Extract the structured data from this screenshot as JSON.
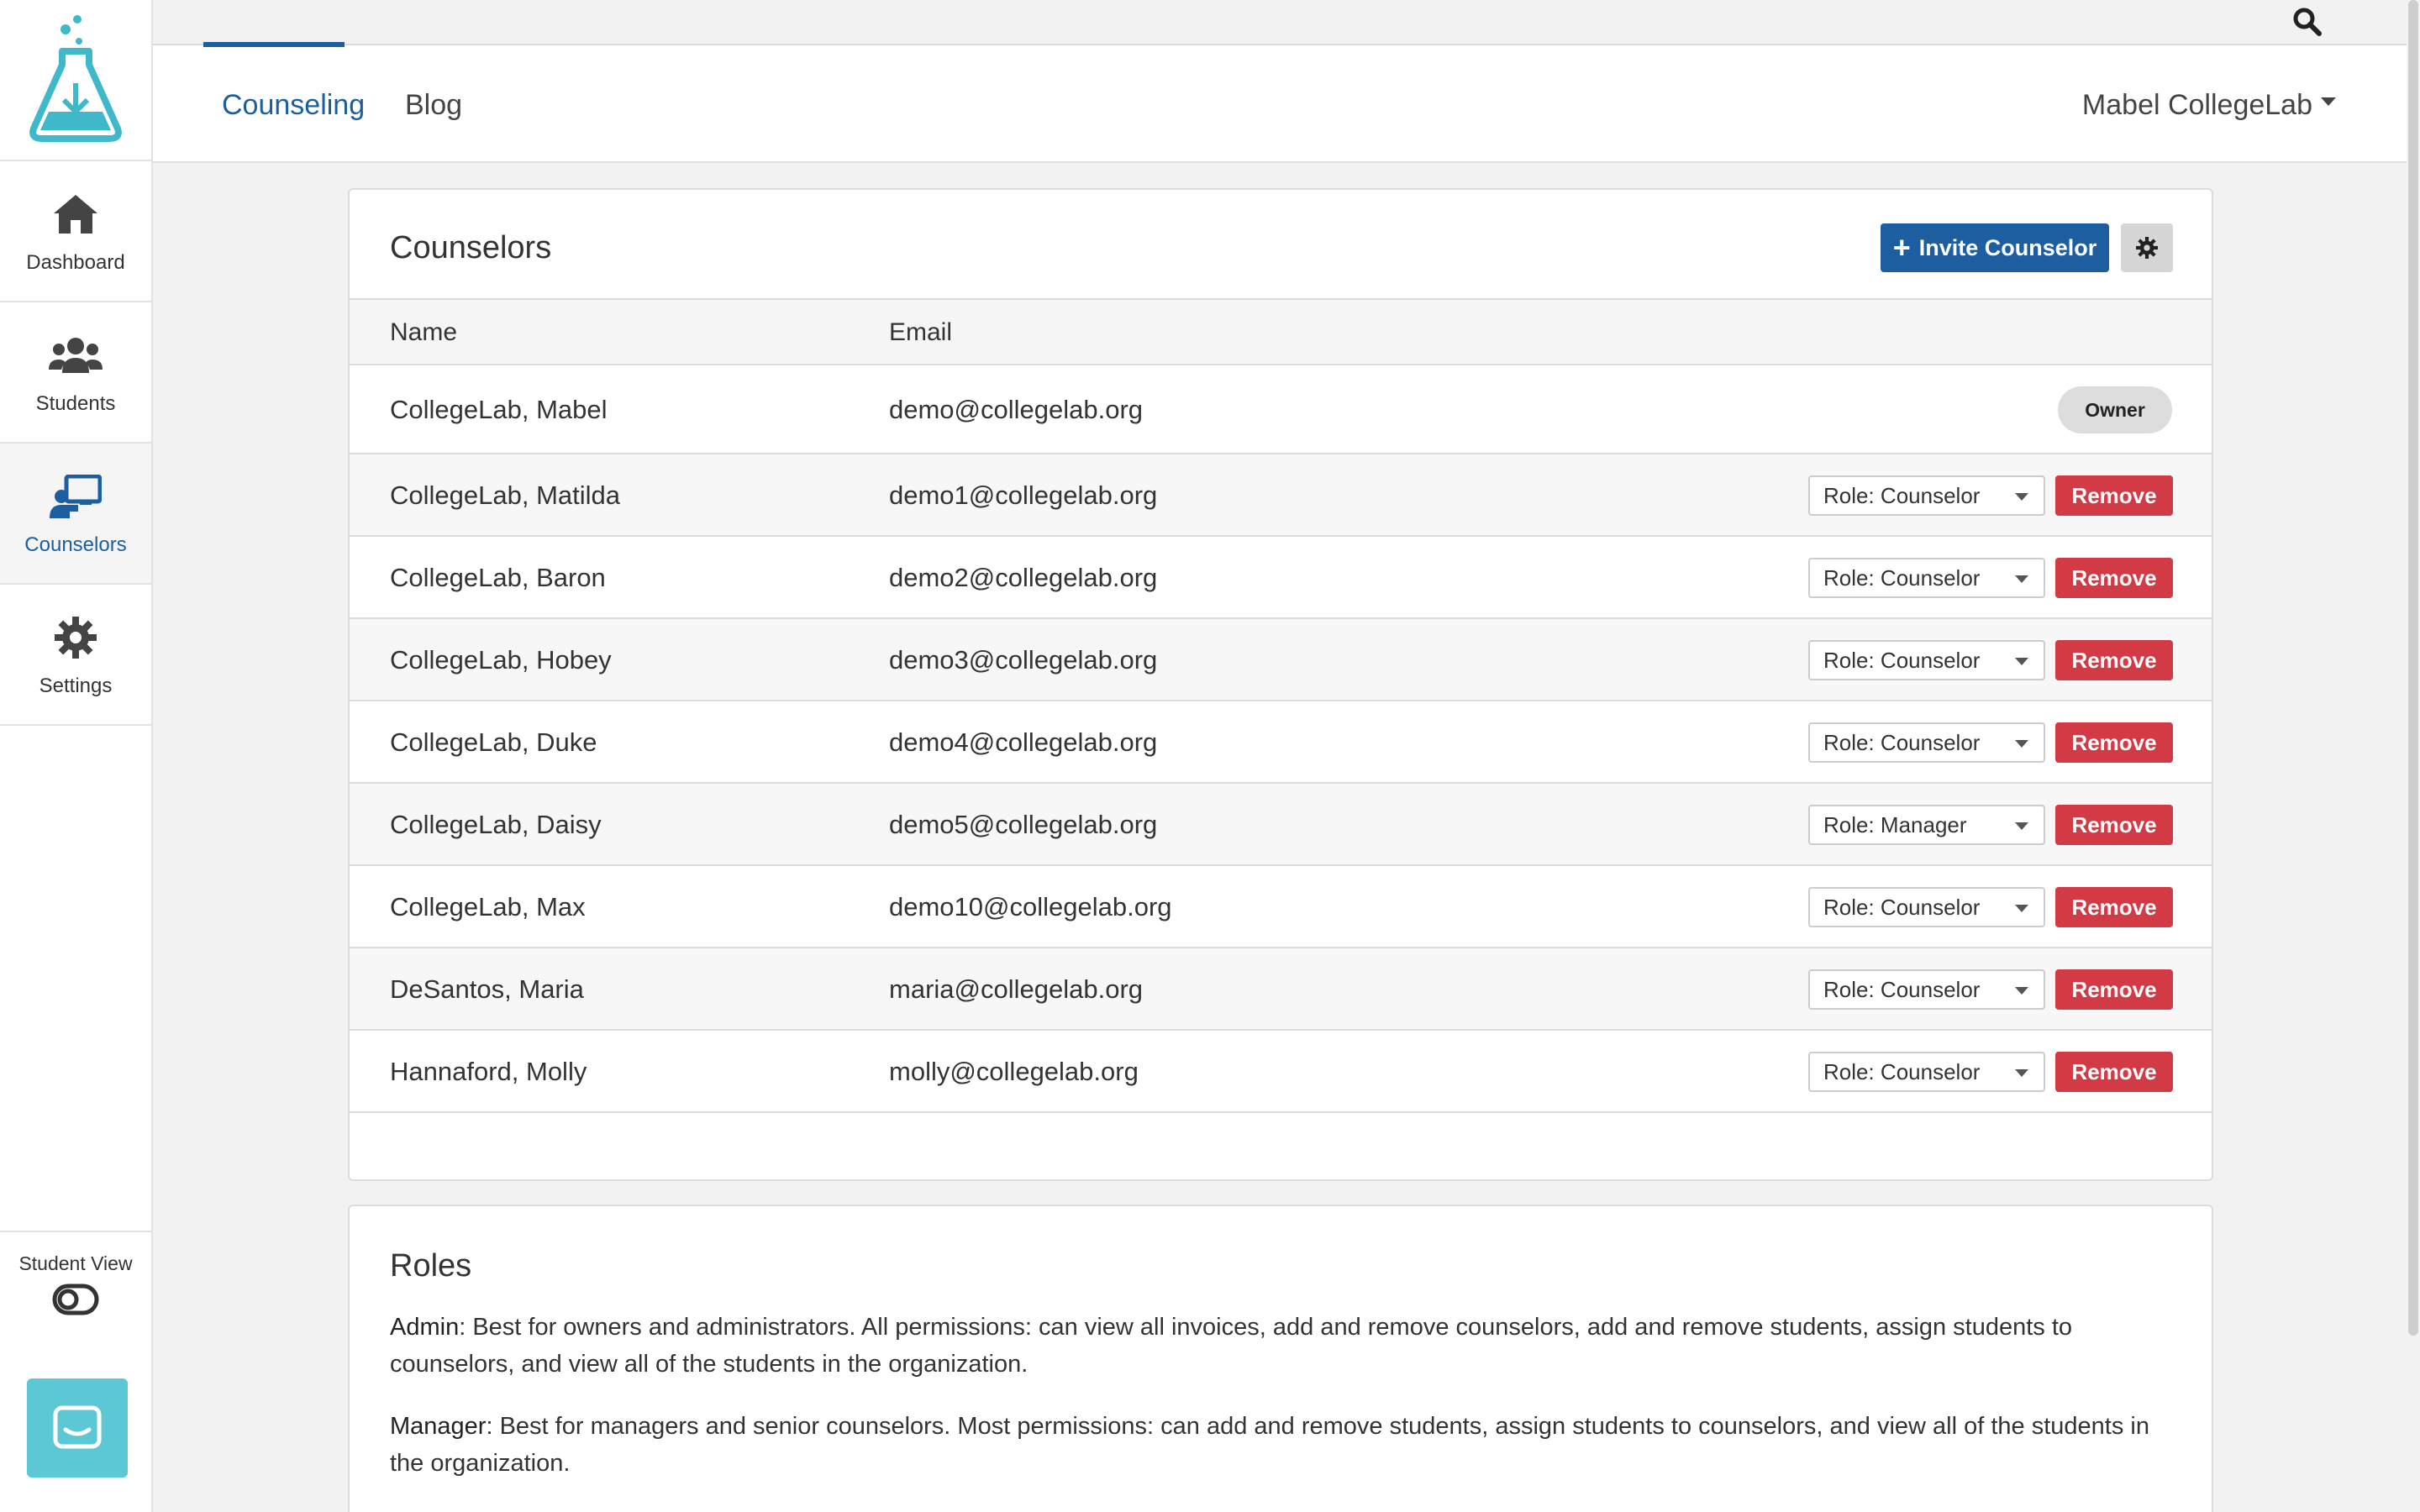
{
  "sidebar": {
    "items": [
      {
        "label": "Dashboard",
        "icon": "home-icon"
      },
      {
        "label": "Students",
        "icon": "users-icon"
      },
      {
        "label": "Counselors",
        "icon": "chalkboard-teacher-icon"
      },
      {
        "label": "Settings",
        "icon": "gear-icon"
      }
    ],
    "student_view_label": "Student View"
  },
  "header": {
    "tabs": [
      {
        "label": "Counseling"
      },
      {
        "label": "Blog"
      }
    ],
    "user_name": "Mabel CollegeLab"
  },
  "counselors": {
    "title": "Counselors",
    "invite_label": "Invite Counselor",
    "columns": [
      "Name",
      "Email"
    ],
    "owner_label": "Owner",
    "remove_label": "Remove",
    "rows": [
      {
        "name": "CollegeLab, Mabel",
        "email": "demo@collegelab.org",
        "role": "Owner"
      },
      {
        "name": "CollegeLab, Matilda",
        "email": "demo1@collegelab.org",
        "role": "Role: Counselor"
      },
      {
        "name": "CollegeLab, Baron",
        "email": "demo2@collegelab.org",
        "role": "Role: Counselor"
      },
      {
        "name": "CollegeLab, Hobey",
        "email": "demo3@collegelab.org",
        "role": "Role: Counselor"
      },
      {
        "name": "CollegeLab, Duke",
        "email": "demo4@collegelab.org",
        "role": "Role: Counselor"
      },
      {
        "name": "CollegeLab, Daisy",
        "email": "demo5@collegelab.org",
        "role": "Role: Manager"
      },
      {
        "name": "CollegeLab, Max",
        "email": "demo10@collegelab.org",
        "role": "Role: Counselor"
      },
      {
        "name": "DeSantos, Maria",
        "email": "maria@collegelab.org",
        "role": "Role: Counselor"
      },
      {
        "name": "Hannaford, Molly",
        "email": "molly@collegelab.org",
        "role": "Role: Counselor"
      }
    ]
  },
  "roles": {
    "title": "Roles",
    "admin_term": "Admin",
    "admin_text": ": Best for owners and administrators. All permissions: can view all invoices, add and remove counselors, add and remove students, assign students to counselors, and view all of the students in the organization.",
    "manager_term": "Manager",
    "manager_text": ": Best for managers and senior counselors. Most permissions: can add and remove students, assign students to counselors, and view all of the students in the organization."
  },
  "colors": {
    "brand_blue": "#1c5ea0",
    "remove_red": "#d23a45",
    "logo_teal": "#3fb8c9",
    "chat_teal": "#5cc8d6"
  }
}
